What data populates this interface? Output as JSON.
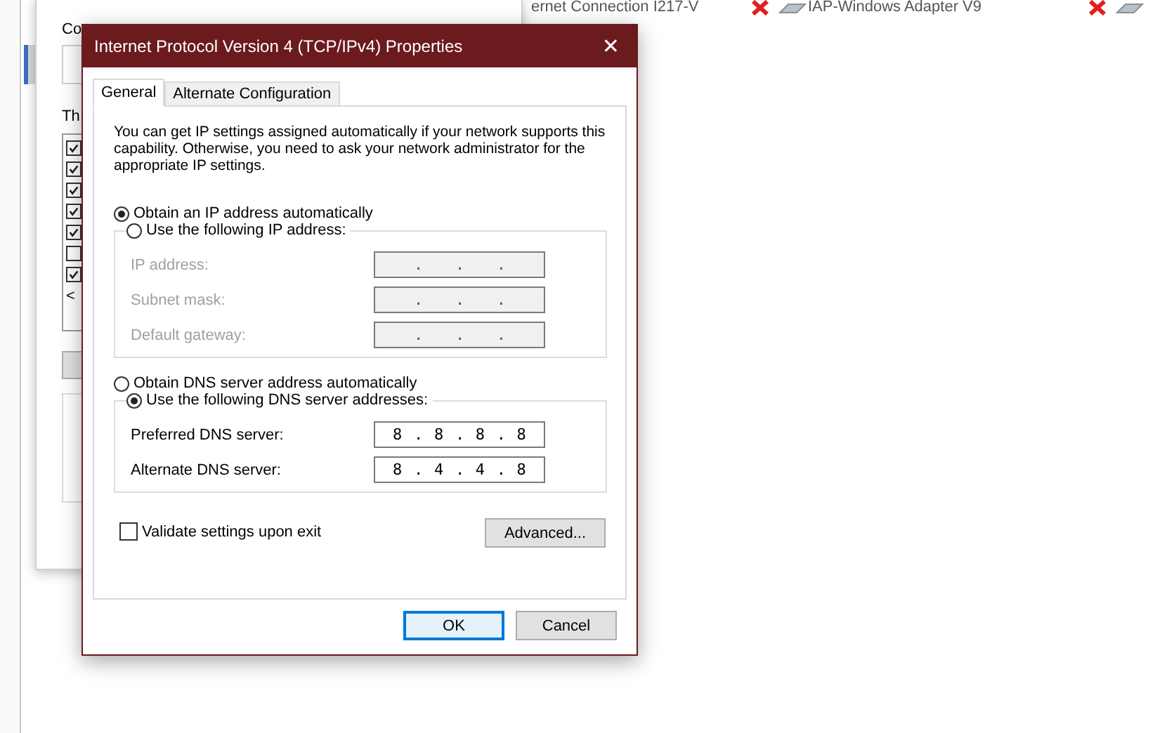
{
  "background": {
    "adapters": [
      {
        "name": "ernet Connection I217-V",
        "disabled": true
      },
      {
        "name": "IAP-Windows Adapter V9",
        "disabled": true
      }
    ],
    "window": {
      "label_top": "Co",
      "label_list": "Th",
      "items": [
        {
          "checked": true
        },
        {
          "checked": true
        },
        {
          "checked": true
        },
        {
          "checked": true
        },
        {
          "checked": true
        },
        {
          "checked": false
        },
        {
          "checked": true
        }
      ],
      "scroll_arrow": "<"
    }
  },
  "dialog": {
    "title": "Internet Protocol Version 4 (TCP/IPv4) Properties",
    "close": "✕",
    "tabs": [
      {
        "label": "General",
        "selected": true
      },
      {
        "label": "Alternate Configuration",
        "selected": false
      }
    ],
    "description": "You can get IP settings assigned automatically if your network supports this capability. Otherwise, you need to ask your network administrator for the appropriate IP settings.",
    "ip_options": [
      {
        "label": "Obtain an IP address automatically",
        "selected": true
      },
      {
        "label": "Use the following IP address:",
        "selected": false
      }
    ],
    "ip_fields": [
      {
        "label": "IP address:",
        "separators": [
          ".",
          ".",
          "."
        ]
      },
      {
        "label": "Subnet mask:",
        "separators": [
          ".",
          ".",
          "."
        ]
      },
      {
        "label": "Default gateway:",
        "separators": [
          ".",
          ".",
          "."
        ]
      }
    ],
    "dns_options": [
      {
        "label": "Obtain DNS server address automatically",
        "selected": false
      },
      {
        "label": "Use the following DNS server addresses:",
        "selected": true
      }
    ],
    "dns_fields": [
      {
        "label": "Preferred DNS server:",
        "octets": [
          "8",
          "8",
          "8",
          "8"
        ],
        "separators": [
          ".",
          ".",
          "."
        ]
      },
      {
        "label": "Alternate DNS server:",
        "octets": [
          "8",
          "4",
          "4",
          "8"
        ],
        "separators": [
          ".",
          ".",
          "."
        ]
      }
    ],
    "validate": {
      "label": "Validate settings upon exit",
      "checked": false
    },
    "advanced_button": "Advanced...",
    "buttons": [
      {
        "label": "OK",
        "default": true
      },
      {
        "label": "Cancel",
        "default": false
      }
    ]
  }
}
